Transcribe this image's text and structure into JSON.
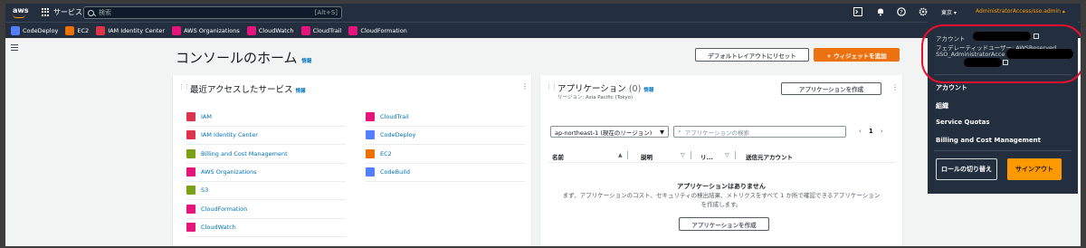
{
  "nav": {
    "logo": "aws",
    "services_label": "サービス",
    "search_placeholder": "検索",
    "search_shortcut": "[Alt+S]",
    "region": "東京 ▾",
    "user": "AdministratorAccess/sso.admin ▴"
  },
  "favorites": [
    {
      "label": "CodeDeploy",
      "color": "#527fff"
    },
    {
      "label": "EC2",
      "color": "#ed7100"
    },
    {
      "label": "IAM Identity Center",
      "color": "#dd344c"
    },
    {
      "label": "AWS Organizations",
      "color": "#e7157b"
    },
    {
      "label": "CloudWatch",
      "color": "#e7157b"
    },
    {
      "label": "CloudTrail",
      "color": "#e7157b"
    },
    {
      "label": "CloudFormation",
      "color": "#e7157b"
    }
  ],
  "page": {
    "title": "コンソールのホーム",
    "info": "情報",
    "reset_layout": "デフォルトレイアウトにリセット",
    "add_widget": "+ ウィジェットを追加"
  },
  "recent": {
    "title": "最近アクセスしたサービス",
    "info": "情報",
    "left": [
      {
        "label": "IAM",
        "color": "#dd344c"
      },
      {
        "label": "IAM Identity Center",
        "color": "#dd344c"
      },
      {
        "label": "Billing and Cost Management",
        "color": "#7aa116"
      },
      {
        "label": "AWS Organizations",
        "color": "#e7157b"
      },
      {
        "label": "S3",
        "color": "#7aa116"
      },
      {
        "label": "CloudFormation",
        "color": "#e7157b"
      },
      {
        "label": "CloudWatch",
        "color": "#e7157b"
      }
    ],
    "right": [
      {
        "label": "CloudTrail",
        "color": "#e7157b"
      },
      {
        "label": "CodeDeploy",
        "color": "#527fff"
      },
      {
        "label": "EC2",
        "color": "#ed7100"
      },
      {
        "label": "CodeBuild",
        "color": "#527fff"
      }
    ]
  },
  "apps": {
    "title": "アプリケーション",
    "count": "(0)",
    "info": "情報",
    "region_note": "リージョン: Asia Pacific (Tokyo)",
    "create_label": "アプリケーションを作成",
    "region_select": "ap-northeast-1 (現在のリージョン)",
    "search_placeholder": "アプリケーションの検索",
    "page": "1",
    "columns": [
      "名前",
      "説明",
      "リ...",
      "送信元アカウント"
    ],
    "empty_title": "アプリケーションはありません",
    "empty_desc_1": "まず、アプリケーションのコスト、セキュリティの検出結果、メトリクスをすべて 1 か所で確認できるアプリケーション",
    "empty_desc_2": "を作成します。",
    "empty_button": "アプリケーションを作成"
  },
  "account_menu": {
    "account_label": "アカウント",
    "federated_label": "フェデレーティッドユーザー: AWSReserved",
    "federated_cont": "SSO_AdministratorAcce",
    "items": [
      "アカウント",
      "組織",
      "Service Quotas",
      "Billing and Cost Management"
    ],
    "switch_role": "ロールの切り替え",
    "sign_out": "サインアウト",
    "signout_color": "#ff9900",
    "highlight_color": "#e8112d"
  }
}
